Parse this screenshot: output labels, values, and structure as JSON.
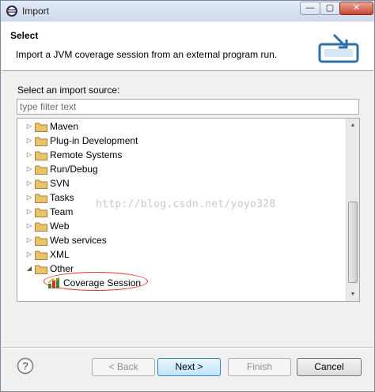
{
  "window": {
    "title": "Import",
    "min_glyph": "—",
    "max_glyph": "▢",
    "close_glyph": "✕"
  },
  "banner": {
    "title": "Select",
    "description": "Import a JVM coverage session from an external program run."
  },
  "source": {
    "label": "Select an import source:",
    "filter_placeholder": "type filter text",
    "filter_value": ""
  },
  "tree": {
    "items": [
      {
        "label": "Maven",
        "expanded": false
      },
      {
        "label": "Plug-in Development",
        "expanded": false
      },
      {
        "label": "Remote Systems",
        "expanded": false
      },
      {
        "label": "Run/Debug",
        "expanded": false
      },
      {
        "label": "SVN",
        "expanded": false
      },
      {
        "label": "Tasks",
        "expanded": false
      },
      {
        "label": "Team",
        "expanded": false
      },
      {
        "label": "Web",
        "expanded": false
      },
      {
        "label": "Web services",
        "expanded": false
      },
      {
        "label": "XML",
        "expanded": false
      },
      {
        "label": "Other",
        "expanded": true
      }
    ],
    "child": {
      "label": "Coverage Session",
      "selected": false
    }
  },
  "watermark": "http://blog.csdn.net/yoyo328",
  "buttons": {
    "help": "?",
    "back": "< Back",
    "next": "Next >",
    "finish": "Finish",
    "cancel": "Cancel"
  },
  "icons": {
    "collapsed": "▷",
    "expanded": "◢",
    "scroll_up": "▲",
    "scroll_down": "▼"
  },
  "colors": {
    "folder": "#e8c36a",
    "highlight": "#e0332b",
    "default_button": "#bee6fd"
  }
}
